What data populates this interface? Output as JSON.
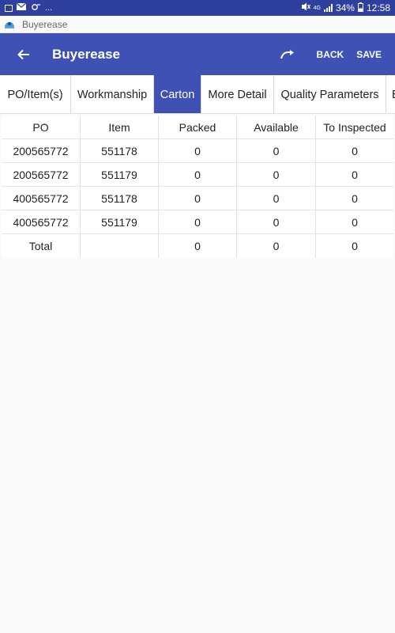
{
  "status_bar": {
    "left_extra": "...",
    "network": "4G",
    "battery": "34%",
    "time": "12:58"
  },
  "title_strip": {
    "app_name": "Buyerease"
  },
  "app_bar": {
    "title": "Buyerease",
    "back_label": "BACK",
    "save_label": "SAVE"
  },
  "tabs": [
    {
      "label": "PO/Item(s)",
      "active": false
    },
    {
      "label": "Workmanship",
      "active": false
    },
    {
      "label": "Carton",
      "active": true
    },
    {
      "label": "More Detail",
      "active": false
    },
    {
      "label": "Quality Parameters",
      "active": false
    },
    {
      "label": "E",
      "active": false
    }
  ],
  "table": {
    "headers": [
      "PO",
      "Item",
      "Packed",
      "Available",
      "To Inspected"
    ],
    "rows": [
      [
        "200565772",
        "551178",
        "0",
        "0",
        "0"
      ],
      [
        "200565772",
        "551179",
        "0",
        "0",
        "0"
      ],
      [
        "400565772",
        "551178",
        "0",
        "0",
        "0"
      ],
      [
        "400565772",
        "551179",
        "0",
        "0",
        "0"
      ]
    ],
    "total": [
      "Total",
      "",
      "0",
      "0",
      "0"
    ]
  },
  "colors": {
    "primary": "#3f51b5",
    "status_bar": "#2f3f9e",
    "background": "#fafafa"
  }
}
